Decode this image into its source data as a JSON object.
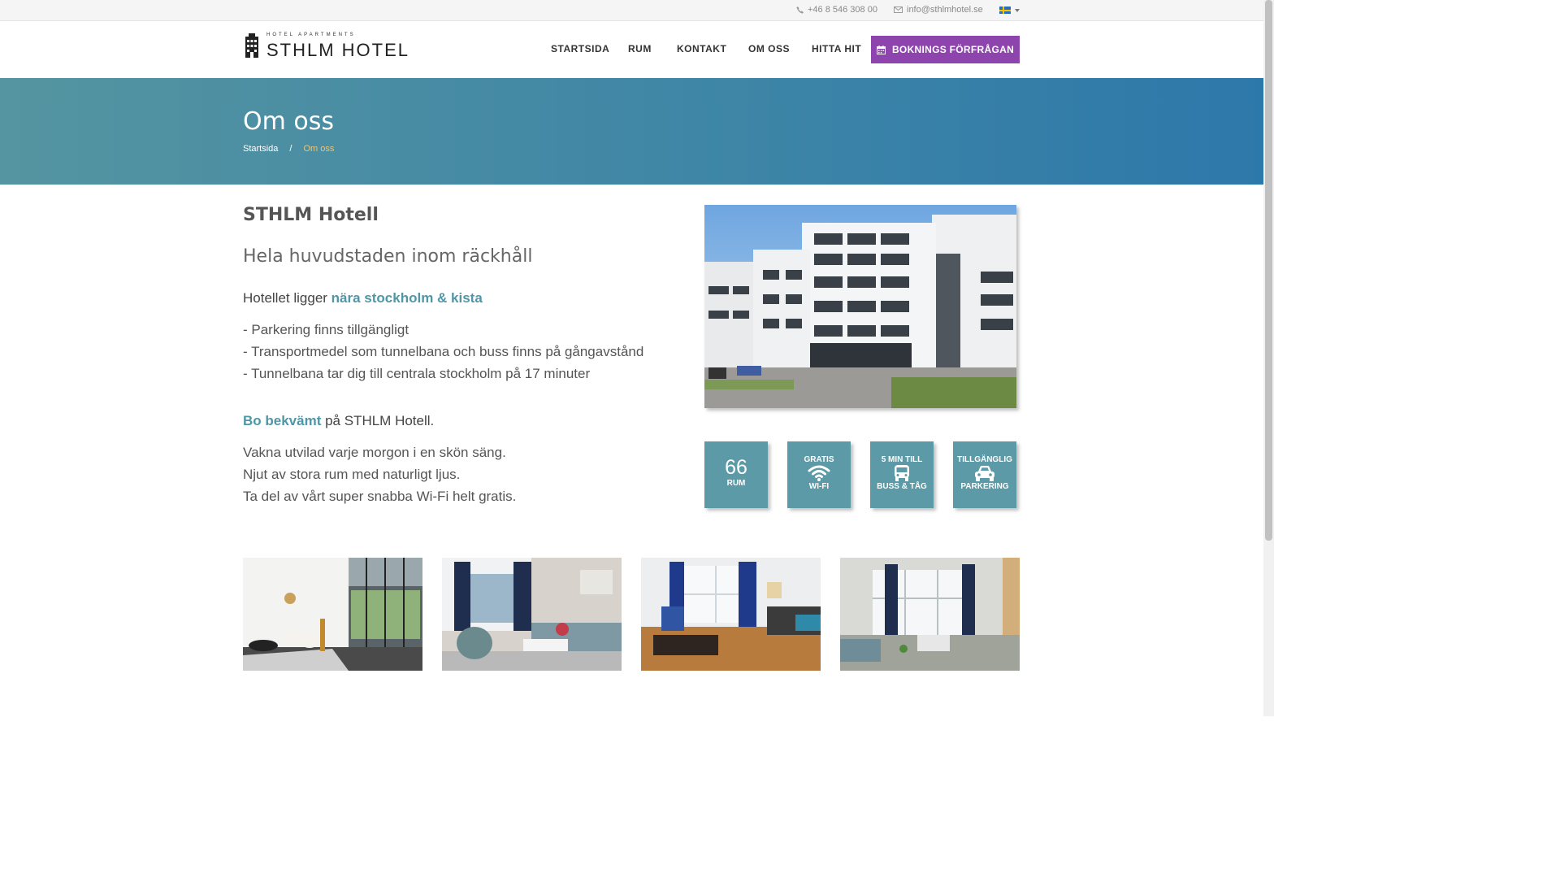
{
  "topbar": {
    "phone": "+46 8 546 308 00",
    "email": "info@sthlmhotel.se",
    "language_icon": "swedish-flag-icon"
  },
  "logo": {
    "small_text": "HOTEL APARTMENTS",
    "big_text": "STHLM HOTEL"
  },
  "nav": {
    "items": [
      "STARTSIDA",
      "RUM",
      "KONTAKT",
      "OM OSS",
      "HITTA HIT"
    ],
    "booking_button": "BOKNINGS FÖRFRÅGAN"
  },
  "hero": {
    "title": "Om oss",
    "breadcrumb_home": "Startsida",
    "breadcrumb_sep": "/",
    "breadcrumb_current": "Om oss"
  },
  "content": {
    "title": "STHLM Hotell",
    "subtitle": "Hela huvudstaden inom räckhåll",
    "intro_prefix": "Hotellet ligger ",
    "intro_highlight": "nära stockholm & kista",
    "bullets": [
      "- Parkering finns tillgängligt",
      "- Transportmedel som tunnelbana och buss finns på gångavstånd",
      "- Tunnelbana tar dig till centrala stockholm på 17 minuter"
    ],
    "bo_highlight": "Bo bekvämt",
    "bo_suffix": " på STHLM Hotell.",
    "comfort_lines": [
      "Vakna utvilad varje morgon i en skön säng.",
      "Njut av stora rum med naturligt ljus.",
      "Ta del av vårt super snabba Wi-Fi helt gratis."
    ]
  },
  "tiles": {
    "rooms_number": "66",
    "rooms_label": "RUM",
    "wifi_top": "GRATIS",
    "wifi_bottom": "WI-FI",
    "transport_top": "5 MIN TILL",
    "transport_bottom": "BUSS & TÅG",
    "parking_top": "TILLGÄNGLIG",
    "parking_bottom": "PARKERING"
  },
  "colors": {
    "accent": "#4f96a6",
    "booking_button": "#8e44ad",
    "tile": "#5b9aa6",
    "breadcrumb_current": "#f0c36d"
  }
}
